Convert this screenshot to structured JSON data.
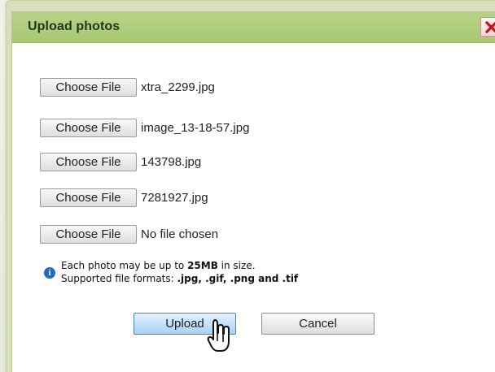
{
  "dialog": {
    "title": "Upload photos",
    "close_icon": "close-icon"
  },
  "files": [
    {
      "button_label": "Choose File",
      "filename": "xtra_2299.jpg"
    },
    {
      "button_label": "Choose File",
      "filename": "image_13-18-57.jpg"
    },
    {
      "button_label": "Choose File",
      "filename": "143798.jpg"
    },
    {
      "button_label": "Choose File",
      "filename": "7281927.jpg"
    },
    {
      "button_label": "Choose File",
      "filename": "No file chosen"
    }
  ],
  "info": {
    "icon": "info-icon",
    "line1_prefix": "Each photo may be up to ",
    "size_limit": "25MB",
    "line1_suffix": " in size.",
    "line2_prefix": "Supported file formats: ",
    "formats": ".jpg, .gif, .png and .tif"
  },
  "actions": {
    "upload_label": "Upload",
    "cancel_label": "Cancel"
  },
  "colors": {
    "title_bar": "#adc97a",
    "close": "#cc1111",
    "info": "#1f69c9",
    "upload_button": "#b7dcf8"
  }
}
